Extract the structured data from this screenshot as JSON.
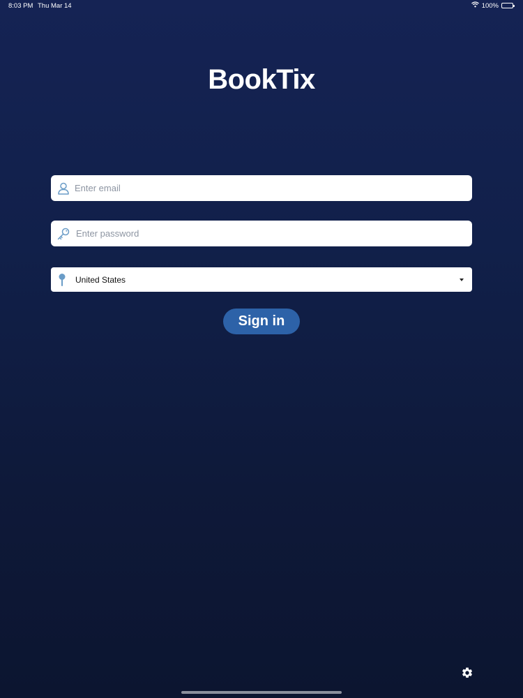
{
  "status_bar": {
    "time": "8:03 PM",
    "date": "Thu Mar 14",
    "battery": "100%",
    "wifi_icon": "wifi-icon",
    "battery_icon": "battery-icon"
  },
  "app": {
    "logo_text": "BookTix"
  },
  "login_form": {
    "email": {
      "placeholder": "Enter email",
      "value": "",
      "icon": "user-icon"
    },
    "password": {
      "placeholder": "Enter password",
      "value": "",
      "icon": "key-icon"
    },
    "country": {
      "selected": "United States",
      "icon": "location-pin-icon"
    },
    "signin_label": "Sign in"
  },
  "footer": {
    "settings_icon": "gear-icon"
  },
  "colors": {
    "background_top": "#152354",
    "background_bottom": "#0c1530",
    "accent": "#2d62a8",
    "icon_blue": "#6a9cc7"
  }
}
